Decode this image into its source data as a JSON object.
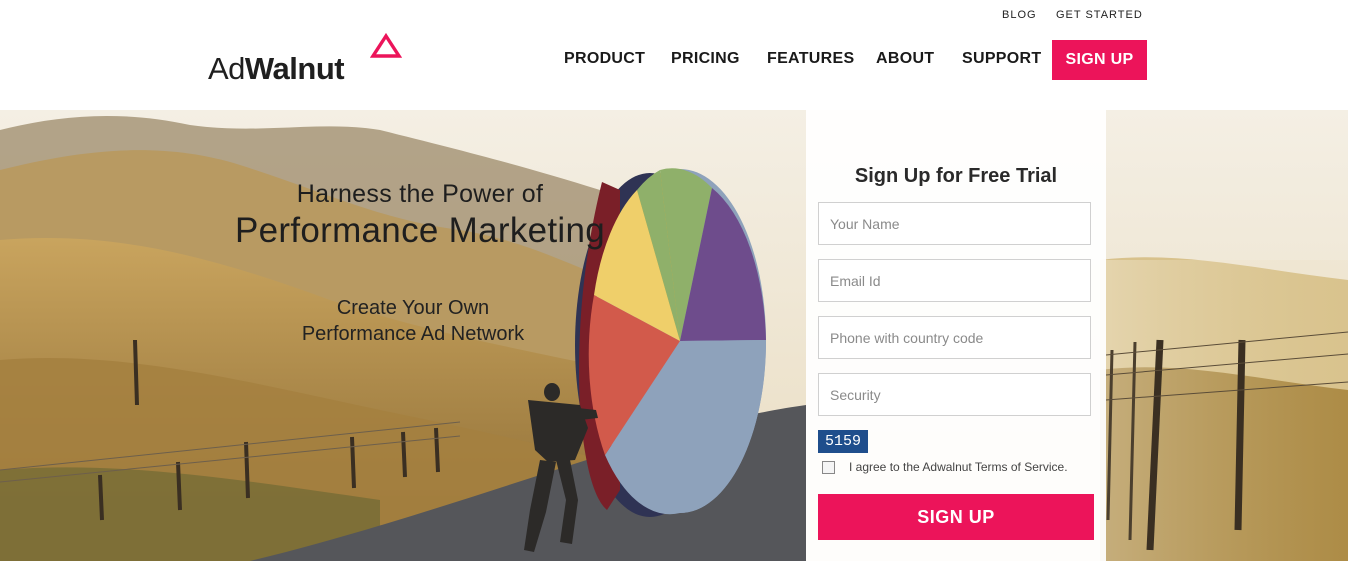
{
  "header": {
    "utility_links": [
      "BLOG",
      "GET STARTED"
    ],
    "logo": {
      "text_regular": "Ad",
      "text_bold": "Walnut"
    },
    "nav": [
      "PRODUCT",
      "PRICING",
      "FEATURES",
      "ABOUT",
      "SUPPORT"
    ],
    "signup_label": "SIGN UP"
  },
  "hero": {
    "headline_line1": "Harness the Power of",
    "headline_line2": "Performance Marketing",
    "sub_line1": "Create Your Own",
    "sub_line2": "Performance Ad Network"
  },
  "form": {
    "title": "Sign Up for Free Trial",
    "name_placeholder": "Your Name",
    "email_placeholder": "Email Id",
    "phone_placeholder": "Phone with country code",
    "security_placeholder": "Security",
    "captcha_code": "5159",
    "agree_text": "I agree to the Adwalnut Terms of Service.",
    "submit_label": "SIGN UP"
  },
  "colors": {
    "brand_pink": "#ec145a",
    "captcha_blue": "#1f4e8c"
  }
}
